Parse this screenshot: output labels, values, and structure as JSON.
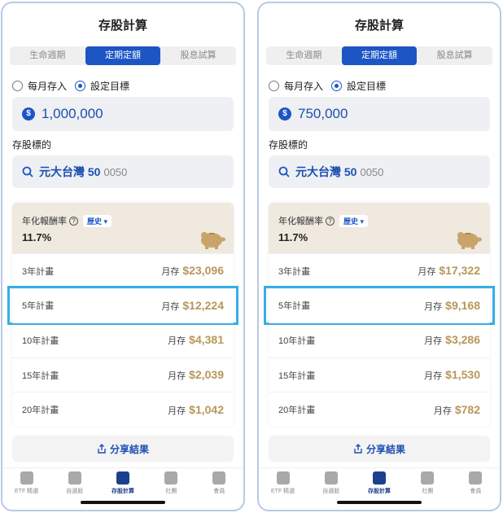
{
  "screens": [
    {
      "title": "存股計算",
      "tabs": [
        "生命週期",
        "定期定額",
        "股息試算"
      ],
      "active_tab": 1,
      "radios": [
        "每月存入",
        "設定目標"
      ],
      "amount": "1,000,000",
      "stock_label": "存股標的",
      "stock_name": "元大台灣 50",
      "stock_code": "0050",
      "rate_label": "年化報酬率",
      "history_label": "歷史 ▾",
      "rate_value": "11.7%",
      "monthly_label": "月存",
      "plans": [
        {
          "name": "3年計畫",
          "value": "$23,096"
        },
        {
          "name": "5年計畫",
          "value": "$12,224"
        },
        {
          "name": "10年計畫",
          "value": "$4,381"
        },
        {
          "name": "15年計畫",
          "value": "$2,039"
        },
        {
          "name": "20年計畫",
          "value": "$1,042"
        }
      ],
      "share_label": "分享結果",
      "nav": [
        "ETF 精選",
        "自選股",
        "存股計算",
        "社團",
        "會員"
      ]
    },
    {
      "title": "存股計算",
      "tabs": [
        "生命週期",
        "定期定額",
        "股息試算"
      ],
      "active_tab": 1,
      "radios": [
        "每月存入",
        "設定目標"
      ],
      "amount": "750,000",
      "stock_label": "存股標的",
      "stock_name": "元大台灣 50",
      "stock_code": "0050",
      "rate_label": "年化報酬率",
      "history_label": "歷史 ▾",
      "rate_value": "11.7%",
      "monthly_label": "月存",
      "plans": [
        {
          "name": "3年計畫",
          "value": "$17,322"
        },
        {
          "name": "5年計畫",
          "value": "$9,168"
        },
        {
          "name": "10年計畫",
          "value": "$3,286"
        },
        {
          "name": "15年計畫",
          "value": "$1,530"
        },
        {
          "name": "20年計畫",
          "value": "$782"
        }
      ],
      "share_label": "分享結果",
      "nav": [
        "ETF 精選",
        "自選股",
        "存股計算",
        "社團",
        "會員"
      ]
    }
  ],
  "highlighted_plan_index": 1,
  "colors": {
    "accent": "#1d55c4",
    "gold_value": "#b8965a",
    "highlight_border": "#36aee8",
    "card_top_bg": "#efe9df"
  }
}
